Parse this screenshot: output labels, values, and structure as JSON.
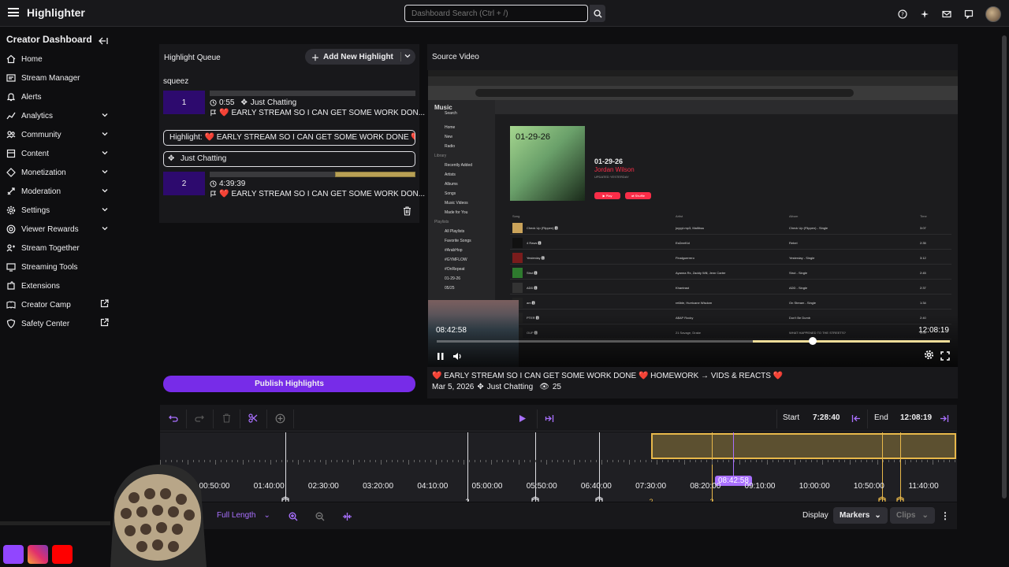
{
  "app": {
    "title": "Highlighter"
  },
  "search": {
    "placeholder": "Dashboard Search (Ctrl + /)"
  },
  "sidebar": {
    "heading": "Creator Dashboard",
    "items": [
      {
        "label": "Home",
        "icon": "home-icon",
        "chevron": false
      },
      {
        "label": "Stream Manager",
        "icon": "stream-manager-icon",
        "chevron": false
      },
      {
        "label": "Alerts",
        "icon": "bell-icon",
        "chevron": false
      },
      {
        "label": "Analytics",
        "icon": "analytics-icon",
        "chevron": true
      },
      {
        "label": "Community",
        "icon": "community-icon",
        "chevron": true
      },
      {
        "label": "Content",
        "icon": "content-icon",
        "chevron": true
      },
      {
        "label": "Monetization",
        "icon": "monetization-icon",
        "chevron": true
      },
      {
        "label": "Moderation",
        "icon": "sword-icon",
        "chevron": true
      },
      {
        "label": "Settings",
        "icon": "gear-icon",
        "chevron": true
      },
      {
        "label": "Viewer Rewards",
        "icon": "rewards-icon",
        "chevron": true
      },
      {
        "label": "Stream Together",
        "icon": "stream-together-icon",
        "chevron": false
      },
      {
        "label": "Streaming Tools",
        "icon": "tools-icon",
        "chevron": false
      },
      {
        "label": "Extensions",
        "icon": "extensions-icon",
        "chevron": false
      },
      {
        "label": "Creator Camp",
        "icon": "creator-camp-icon",
        "external": true
      },
      {
        "label": "Safety Center",
        "icon": "shield-icon",
        "external": true
      }
    ]
  },
  "queue": {
    "title": "Highlight Queue",
    "add_label": "Add New Highlight",
    "user": "squeez",
    "items": [
      {
        "num": "1",
        "duration": "0:55",
        "category": "Just Chatting",
        "title": "EARLY STREAM SO I CAN GET SOME WORK DON...",
        "progress": 0
      },
      {
        "num": "2",
        "duration": "4:39:39",
        "title": "EARLY STREAM SO I CAN GET SOME WORK DON...",
        "progress": 0.39
      }
    ],
    "highlight_field": "Highlight: ❤️ EARLY STREAM SO I CAN GET SOME WORK DONE ❤️ H",
    "category_field": "Just Chatting",
    "publish_label": "Publish Highlights"
  },
  "source": {
    "title": "Source Video",
    "time_current": "08:42:58",
    "time_end": "12:08:19",
    "video_title": "❤️ EARLY STREAM SO I CAN GET SOME WORK DONE ❤️ HOMEWORK → VIDS & REACTS ❤️",
    "date": "Mar 5, 2026",
    "category": "Just Chatting",
    "views": "25",
    "embedded": {
      "app": "Music",
      "sidebar": [
        "Search",
        "Home",
        "New",
        "Radio",
        "Library",
        "Recently Added",
        "Artists",
        "Albums",
        "Songs",
        "Music Videos",
        "Made for You",
        "Playlists",
        "All Playlists",
        "Favorite Songs",
        "#ArabHop",
        "#GYMFLOW",
        "#OnRepeat",
        "01-29-26",
        "05/25"
      ],
      "playlist_cover": "01-29-26",
      "playlist_name": "01-29-26",
      "playlist_artist": "Jordan Wilson",
      "updated": "UPDATED YESTERDAY",
      "play": "▶ Play",
      "shuffle": "⇄ Shuffle",
      "headers": [
        "Song",
        "Artist",
        "Album",
        "Time"
      ],
      "rows": [
        {
          "song": "Check Up (Flippen) 🅴",
          "artist": "joyyyt.mp3, Mallibuu",
          "album": "Check Up (Flippen) - Single",
          "time": "3:07"
        },
        {
          "song": "4 Raws 🅴",
          "artist": "EsDeeKid",
          "album": "Rebel",
          "time": "2:35"
        },
        {
          "song": "Yesterday 🅴",
          "artist": "Finalguerrero",
          "album": "Yesterday - Single",
          "time": "3:12"
        },
        {
          "song": "Strut 🅴",
          "artist": "Ayanna Rx, Zaddy Will, Jenn Carter",
          "album": "Strut - Single",
          "time": "2:45"
        },
        {
          "song": "ADD 🅴",
          "artist": "Khantrast",
          "album": "ADD - Single",
          "time": "2:37"
        },
        {
          "song": "am 🅴",
          "artist": "re6ble, Hurricane Wisdom",
          "album": "On Stream - Single",
          "time": "1:34"
        },
        {
          "song": "PTER 🅴",
          "artist": "A$AP Rocky",
          "album": "Don't Be Dumb",
          "time": "2:40"
        },
        {
          "song": "OUP 🅴",
          "artist": "21 Savage, Drake",
          "album": "WHAT HAPPENED TO THE STREETS?",
          "time": "3:04"
        }
      ]
    }
  },
  "timeline": {
    "start_label": "Start",
    "start_value": "7:28:40",
    "end_label": "End",
    "end_value": "12:08:19",
    "cursor": "08:42:58",
    "ticks": [
      "00:50:00",
      "01:40:00",
      "02:30:00",
      "03:20:00",
      "04:10:00",
      "05:00:00",
      "05:50:00",
      "06:40:00",
      "07:30:00",
      "08:20:00",
      "09:10:00",
      "10:00:00",
      "10:50:00",
      "11:40:00"
    ],
    "marker_counts": [
      "2",
      "2",
      "2"
    ],
    "zoom_label": "Full Length",
    "display_label": "Display",
    "markers_label": "Markers",
    "clips_label": "Clips"
  },
  "colors": {
    "accent": "#772ce8",
    "accent_light": "#a970ff",
    "highlight": "#e8b84a",
    "queue_num": "#2d0a6e"
  }
}
